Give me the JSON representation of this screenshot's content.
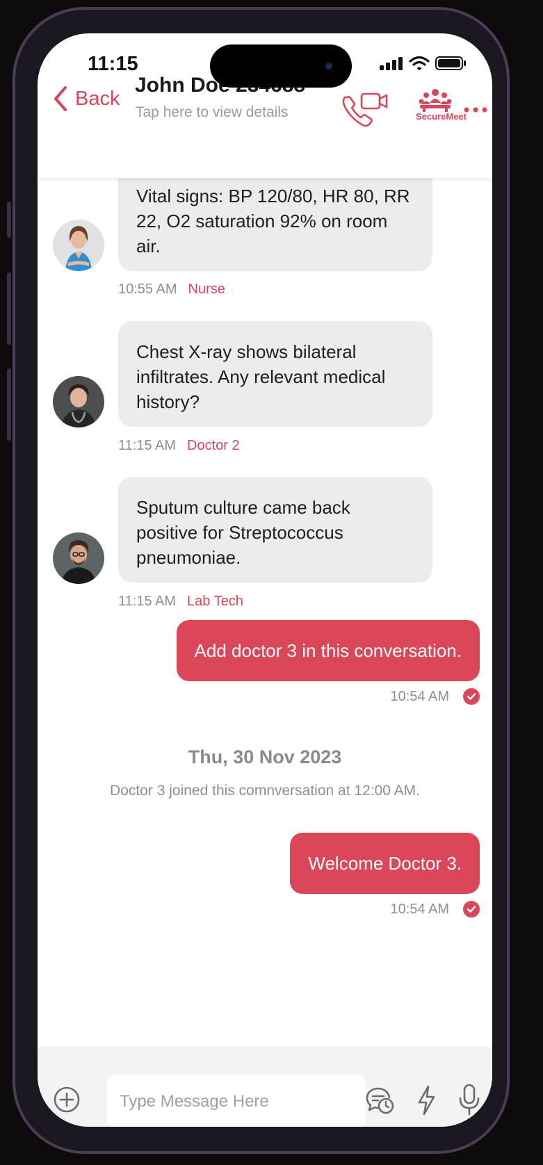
{
  "status_bar": {
    "time": "11:15"
  },
  "header": {
    "back_label": "Back",
    "title": "John Doe 234688",
    "subtitle": "Tap here to view details",
    "securemeet_label": "SecureMeet"
  },
  "messages_in": [
    {
      "text": "Vital signs: BP 120/80, HR 80, RR 22, O2 saturation 92% on room air.",
      "time": "10:55 AM",
      "sender": "Nurse"
    },
    {
      "text": "Chest X-ray shows bilateral infiltrates. Any relevant medical history?",
      "time": "11:15 AM",
      "sender": "Doctor 2"
    },
    {
      "text": "Sputum culture came back positive for Streptococcus pneumoniae.",
      "time": "11:15 AM",
      "sender": "Lab Tech"
    }
  ],
  "messages_out": [
    {
      "text": "Add doctor 3 in this conversation.",
      "time": "10:54 AM"
    },
    {
      "text": "Welcome Doctor 3.",
      "time": "10:54 AM"
    }
  ],
  "date_separator": "Thu, 30 Nov 2023",
  "system_message": "Doctor 3 joined this comnversation at 12:00 AM.",
  "composer": {
    "placeholder": "Type Message Here"
  },
  "colors": {
    "accent": "#dc4659",
    "incoming_bubble": "#ececec"
  }
}
